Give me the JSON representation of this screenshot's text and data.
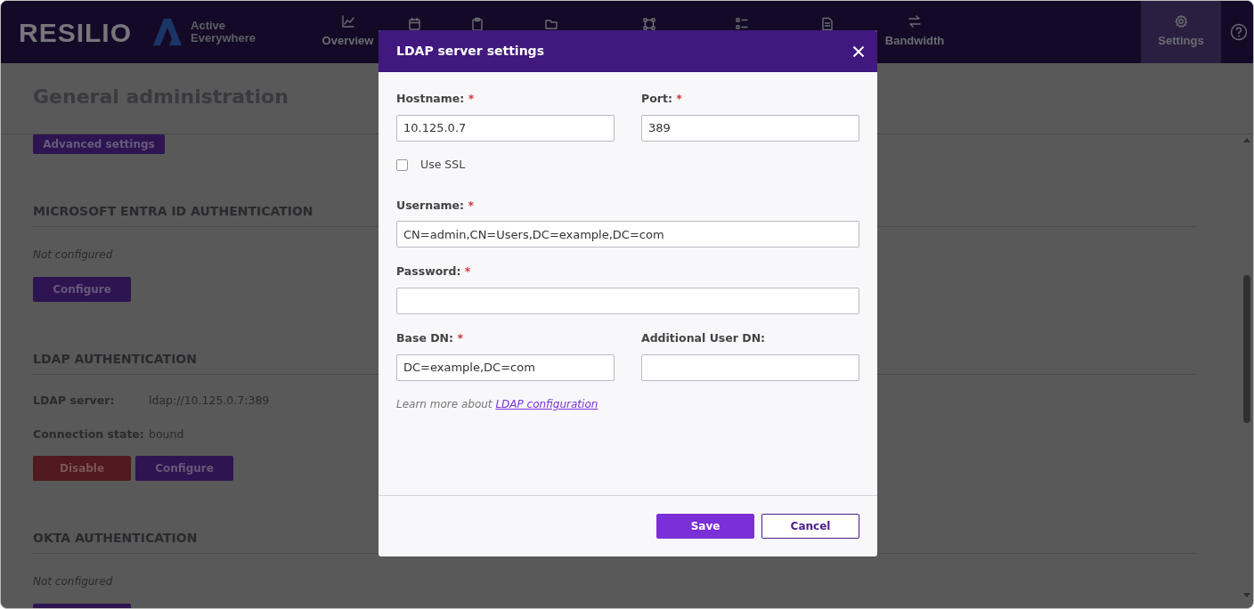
{
  "navbar": {
    "logo": "RESILIO",
    "product": [
      "Active",
      "Everywhere"
    ],
    "items": [
      {
        "label": "Overview",
        "selected": false
      },
      {
        "selected": false
      },
      {
        "selected": false
      },
      {
        "selected": false
      },
      {
        "selected": false
      },
      {
        "selected": false
      },
      {
        "selected": false
      },
      {
        "label": "Bandwidth",
        "selected": false
      },
      {
        "label": "Settings",
        "selected": true
      }
    ]
  },
  "page": {
    "title": "General administration",
    "top_button": {
      "label": "Advanced settings",
      "kind": "primary"
    },
    "sections": [
      {
        "title": "MICROSOFT ENTRA ID AUTHENTICATION",
        "status": "Not configured",
        "buttons": [
          {
            "label": "Configure",
            "kind": "primary"
          }
        ]
      },
      {
        "title": "LDAP AUTHENTICATION",
        "details": [
          {
            "label": "LDAP server:",
            "value": "ldap://10.125.0.7:389"
          },
          {
            "label": "Connection state:",
            "value": "bound"
          }
        ],
        "buttons": [
          {
            "label": "Disable",
            "kind": "danger"
          },
          {
            "label": "Configure",
            "kind": "primary"
          }
        ]
      },
      {
        "title": "OKTA AUTHENTICATION",
        "status": "Not configured",
        "buttons": [
          {
            "kind": "primary"
          }
        ]
      }
    ]
  },
  "modal": {
    "title": "LDAP server settings",
    "rows": [
      [
        {
          "kind": "input",
          "label": "Hostname:",
          "required": true,
          "value": "10.125.0.7"
        },
        {
          "kind": "input",
          "label": "Port:",
          "required": true,
          "value": "389"
        }
      ],
      [
        {
          "kind": "checkbox",
          "label": "Use SSL",
          "checked": false
        }
      ],
      [
        {
          "kind": "input",
          "label": "Username:",
          "required": true,
          "value": "CN=admin,CN=Users,DC=example,DC=com"
        }
      ],
      [
        {
          "kind": "password",
          "label": "Password:",
          "required": true
        }
      ],
      [
        {
          "kind": "input",
          "label": "Base DN:",
          "required": true,
          "value": "DC=example,DC=com"
        },
        {
          "kind": "input",
          "label": "Additional User DN:",
          "required": false
        }
      ]
    ],
    "required_mark": "*",
    "help_text": "Learn more about",
    "help_link": "LDAP configuration",
    "buttons": [
      {
        "label": "Save",
        "kind": "primary"
      },
      {
        "label": "Cancel",
        "kind": "outline"
      }
    ]
  }
}
